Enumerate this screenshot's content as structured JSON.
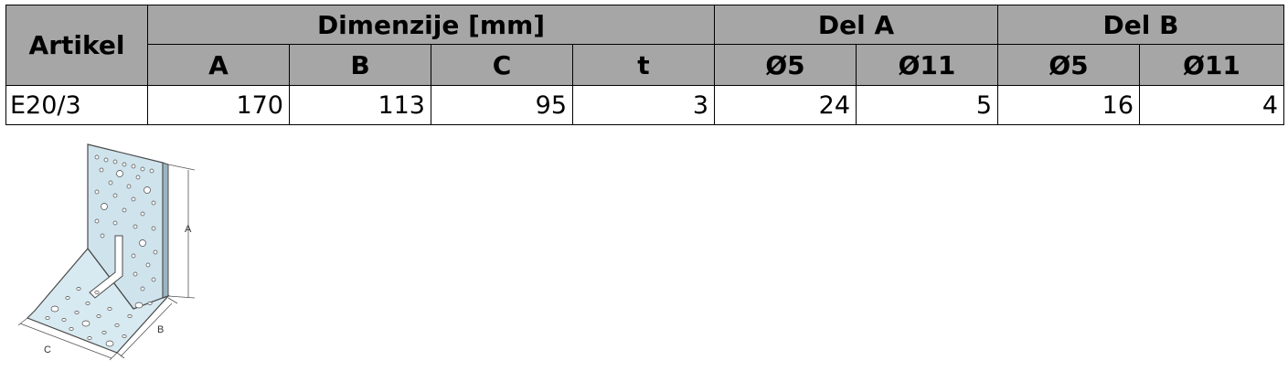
{
  "table": {
    "headers": {
      "artikel": "Artikel",
      "dimenzije": "Dimenzije [mm]",
      "del_a": "Del A",
      "del_b": "Del B",
      "sub": [
        "A",
        "B",
        "C",
        "t",
        "Ø5",
        "Ø11",
        "Ø5",
        "Ø11"
      ]
    },
    "rows": [
      {
        "artikel": "E20/3",
        "a": "170",
        "b": "113",
        "c": "95",
        "t": "3",
        "del_a_d5": "24",
        "del_a_d11": "5",
        "del_b_d5": "16",
        "del_b_d11": "4"
      }
    ]
  },
  "diagram": {
    "label_a": "A",
    "label_b": "B",
    "label_c": "C",
    "plate_color": "#cfe3ec",
    "edge_color": "#4a4a4a"
  }
}
